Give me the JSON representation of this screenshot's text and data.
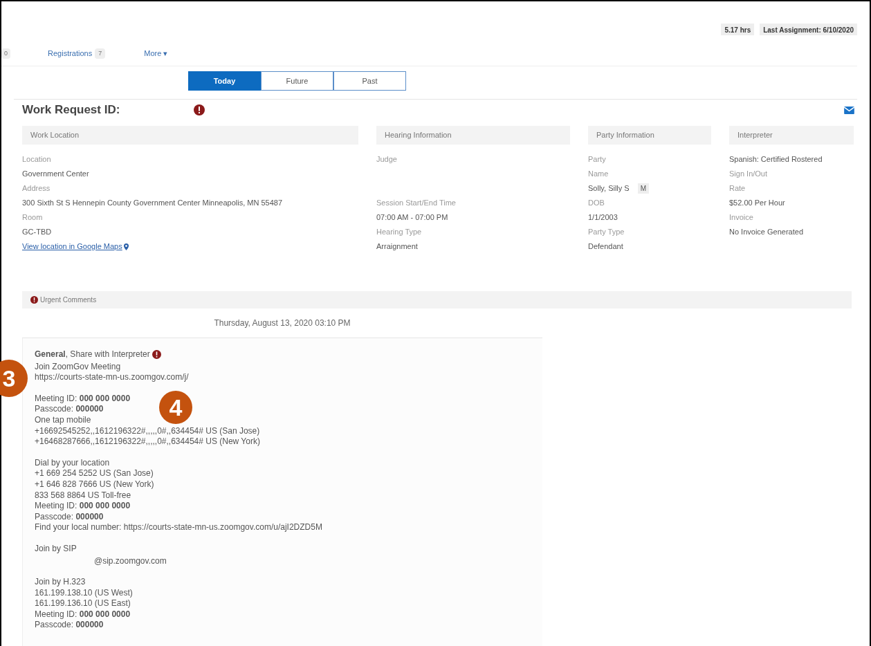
{
  "header_badges": [
    "5.17 hrs",
    "Last Assignment: 6/10/2020"
  ],
  "nav": {
    "cut_count": "0",
    "items": [
      {
        "label": "Registrations",
        "count": "7"
      },
      {
        "label": "More ▾"
      }
    ]
  },
  "tabs": [
    {
      "label": "Today",
      "selected": true
    },
    {
      "label": "Future",
      "selected": false
    },
    {
      "label": "Past",
      "selected": false
    }
  ],
  "title": "Work Request ID:",
  "columns": [
    {
      "heading": "Work Location",
      "fields": [
        {
          "label": "Location",
          "value": "Government Center"
        },
        {
          "label": "Address",
          "value": "300 Sixth St S Hennepin County Government Center Minneapolis, MN 55487"
        },
        {
          "label": "Room",
          "value": "GC-TBD"
        }
      ],
      "link": "View location in Google Maps"
    },
    {
      "heading": "Hearing Information",
      "fields": [
        {
          "label": "Judge",
          "kind": "spaced"
        },
        {
          "label": "Session Start/End Time",
          "value": "07:00 AM - 07:00 PM"
        },
        {
          "label": "Hearing Type",
          "value": "Arraignment"
        }
      ]
    },
    {
      "heading": "Party Information",
      "fields": [
        {
          "label": "Party"
        },
        {
          "label": "Name",
          "value": "Solly, Silly S",
          "tag": "M"
        },
        {
          "label": "DOB",
          "value": "1/1/2003"
        },
        {
          "label": "Party Type",
          "value": "Defendant"
        }
      ]
    },
    {
      "heading": "Interpreter",
      "fields": [
        {
          "value": "Spanish: Certified Rostered"
        },
        {
          "label": "Sign In/Out"
        },
        {
          "label": "Rate",
          "value": "$52.00 Per Hour"
        },
        {
          "label": "Invoice",
          "value": "No Invoice Generated"
        }
      ]
    }
  ],
  "urgent_comments": {
    "heading": "Urgent Comments",
    "date": "Thursday, August 13, 2020 03:10 PM",
    "comment_header": "**General**, Share with Interpreter",
    "paragraphs": [
      {
        "lines": [
          {
            "text": "Join ZoomGov Meeting"
          },
          {
            "text": "https://courts-state-mn-us.zoomgov.com/j/"
          }
        ]
      },
      {
        "lines": [
          {
            "text": "Meeting ID: **000 000 0000**"
          },
          {
            "text": "Passcode: **000000**"
          },
          {
            "text": "One tap mobile"
          },
          {
            "text": "+16692545252,,1612196322#,,,,,0#,,634454# US (San Jose)"
          },
          {
            "text": "+16468287666,,1612196322#,,,,,0#,,634454# US (New York)"
          }
        ]
      },
      {
        "lines": [
          {
            "text": "Dial by your location"
          },
          {
            "text": "+1 669 254 5252 US (San Jose)"
          },
          {
            "text": "+1 646 828 7666 US (New York)"
          },
          {
            "text": "833 568 8864 US Toll-free"
          },
          {
            "text": "Meeting ID: **000 000 0000**"
          },
          {
            "text": "Passcode: **000000**"
          },
          {
            "text": "Find your local number: https://courts-state-mn-us.zoomgov.com/u/ajI2DZD5M"
          }
        ]
      },
      {
        "lines": [
          {
            "text": "Join by SIP"
          },
          {
            "text": "@sip.zoomgov.com",
            "kind": "indented"
          }
        ]
      },
      {
        "lines": [
          {
            "text": "Join by H.323"
          },
          {
            "text": "161.199.138.10 (US West)"
          },
          {
            "text": "161.199.136.10 (US East)"
          },
          {
            "text": "Meeting ID: **000 000 0000**"
          },
          {
            "text": "Passcode: **000000**"
          }
        ]
      }
    ]
  },
  "callouts": [
    {
      "label": "3",
      "kind": "left"
    },
    {
      "label": "4",
      "kind": "inline"
    }
  ]
}
